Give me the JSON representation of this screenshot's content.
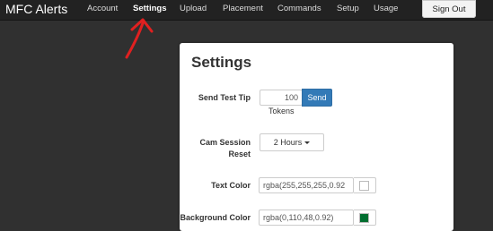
{
  "navbar": {
    "brand": "MFC Alerts",
    "links": [
      {
        "label": "Account"
      },
      {
        "label": "Settings"
      },
      {
        "label": "Upload"
      },
      {
        "label": "Placement"
      },
      {
        "label": "Commands"
      },
      {
        "label": "Setup"
      },
      {
        "label": "Usage"
      }
    ],
    "signout_label": "Sign Out"
  },
  "settings": {
    "title": "Settings",
    "test_tip": {
      "label": "Send Test Tip",
      "value": "100",
      "unit": "Tokens",
      "button_label": "Send"
    },
    "session_reset": {
      "label_line1": "Cam Session",
      "label_line2": "Reset",
      "selected": "2 Hours"
    },
    "text_color": {
      "label": "Text Color",
      "value": "rgba(255,255,255,0.92",
      "swatch": "#ffffff"
    },
    "background_color": {
      "label": "Background Color",
      "value": "rgba(0,110,48,0.92)",
      "swatch": "#006e30"
    }
  },
  "colors": {
    "annotation_arrow": "#e02020",
    "primary_button": "#337ab7"
  }
}
